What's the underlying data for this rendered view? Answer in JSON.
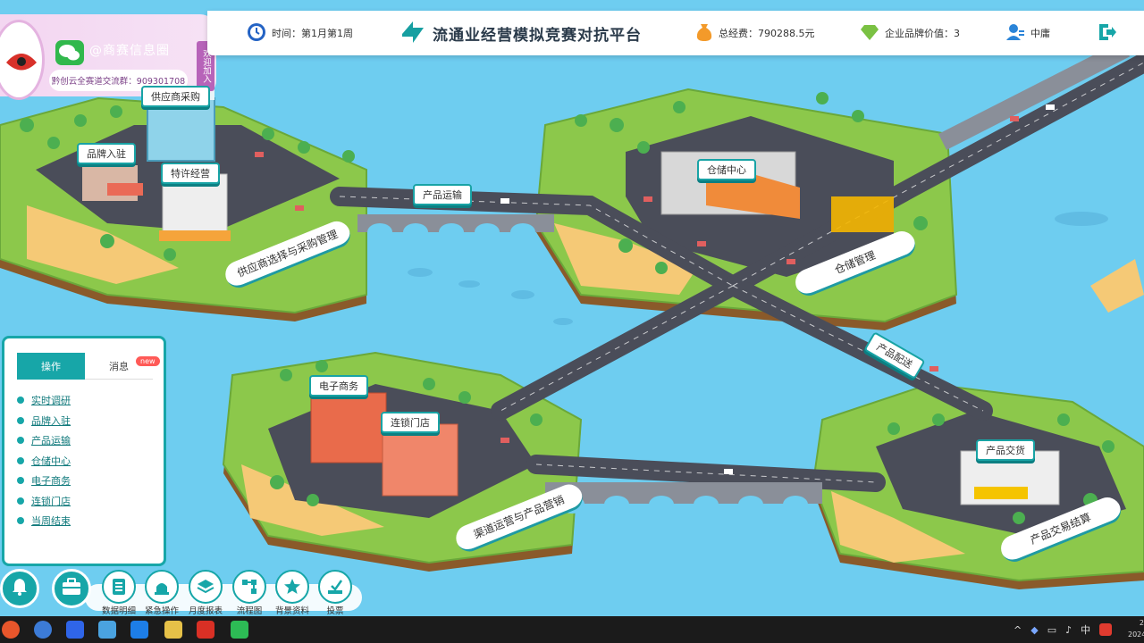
{
  "wechat": {
    "title": "@商赛信息圈",
    "subtitle": "黔创云全赛道交流群：909301708",
    "join": "欢迎加入"
  },
  "header": {
    "time_label": "时间：第1月第1周",
    "title": "流通业经营模拟竞赛对抗平台",
    "total_cost": "总经费：790288.5元",
    "brand_value": "企业品牌价值：3",
    "user": "中庸"
  },
  "map_labels": {
    "supplier": "供应商采购",
    "brand_entry": "品牌入驻",
    "franchise": "特许经营",
    "transport": "产品运输",
    "warehouse": "仓储中心",
    "delivery": "产品配送",
    "ecommerce": "电子商务",
    "chain_store": "连锁门店",
    "trade": "产品交货"
  },
  "banners": {
    "supply": "供应商选择与采购管理",
    "storage": "仓储管理",
    "channel": "渠道运营与产品营销",
    "trade": "产品交易结算"
  },
  "operations": {
    "tab_active": "操作",
    "tab_message": "消息",
    "new_badge": "new",
    "items": [
      "实时调研",
      "品牌入驻",
      "产品运输",
      "仓储中心",
      "电子商务",
      "连锁门店",
      "当周结束"
    ]
  },
  "toolbar": {
    "items": [
      "数据明细",
      "紧急操作",
      "月度报表",
      "流程图",
      "背景资料",
      "投票"
    ]
  },
  "taskbar": {
    "ime": "中",
    "clock_line1": "2",
    "clock_line2": "2024"
  },
  "colors": {
    "accent": "#17a6a8",
    "water": "#6ecdf0",
    "grass": "#8cc84b",
    "road": "#4a4d59"
  }
}
